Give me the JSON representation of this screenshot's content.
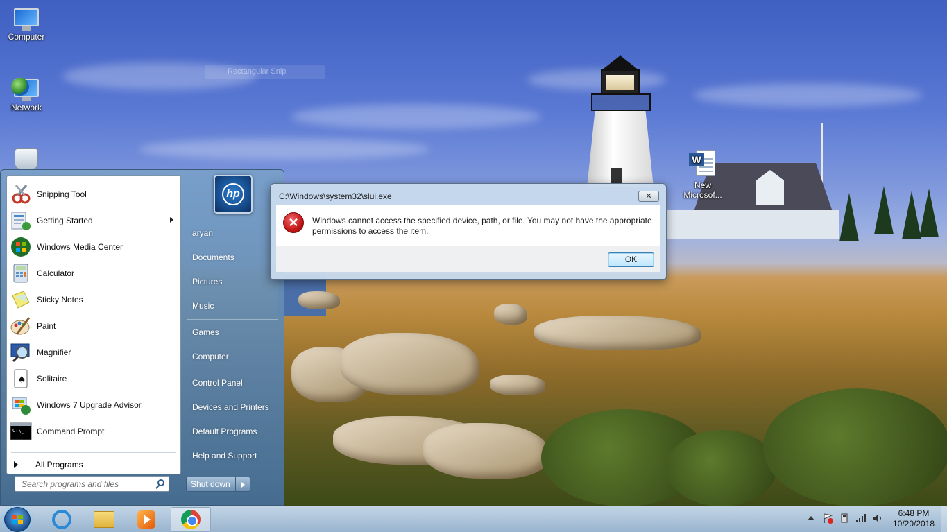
{
  "desktop": {
    "icons": [
      {
        "label": "Computer"
      },
      {
        "label": "Network"
      },
      {
        "label": "Recycle Bin"
      },
      {
        "label": "New Microsof..."
      }
    ],
    "snip_ghost": "Rectangular Snip"
  },
  "start_menu": {
    "programs": [
      {
        "label": "Snipping Tool",
        "icon": "snipping-tool-icon"
      },
      {
        "label": "Getting Started",
        "icon": "getting-started-icon",
        "has_submenu": true
      },
      {
        "label": "Windows Media Center",
        "icon": "media-center-icon"
      },
      {
        "label": "Calculator",
        "icon": "calculator-icon"
      },
      {
        "label": "Sticky Notes",
        "icon": "sticky-notes-icon"
      },
      {
        "label": "Paint",
        "icon": "paint-icon"
      },
      {
        "label": "Magnifier",
        "icon": "magnifier-icon"
      },
      {
        "label": "Solitaire",
        "icon": "solitaire-icon"
      },
      {
        "label": "Windows 7 Upgrade Advisor",
        "icon": "upgrade-advisor-icon"
      },
      {
        "label": "Command Prompt",
        "icon": "command-prompt-icon"
      }
    ],
    "all_programs": "All Programs",
    "search_placeholder": "Search programs and files",
    "user_tile_text": "hp",
    "right_items": [
      "aryan",
      "Documents",
      "Pictures",
      "Music",
      "Games",
      "Computer",
      "Control Panel",
      "Devices and Printers",
      "Default Programs",
      "Help and Support"
    ],
    "shutdown_label": "Shut down"
  },
  "dialog": {
    "title": "C:\\Windows\\system32\\slui.exe",
    "close_glyph": "✕",
    "error_glyph": "✕",
    "message": "Windows cannot access the specified device, path, or file.  You may not have the appropriate permissions to access the item.",
    "ok_label": "OK"
  },
  "taskbar": {
    "pinned": [
      "windows-explorer",
      "internet-explorer",
      "file-explorer",
      "windows-media-player",
      "google-chrome"
    ],
    "time": "6:48 PM",
    "date": "10/20/2018"
  },
  "colors": {
    "dialog_frame": "#c8daec",
    "error_red": "#c41616",
    "ok_border": "#3c7fb1",
    "start_menu": "#5a86b0"
  }
}
